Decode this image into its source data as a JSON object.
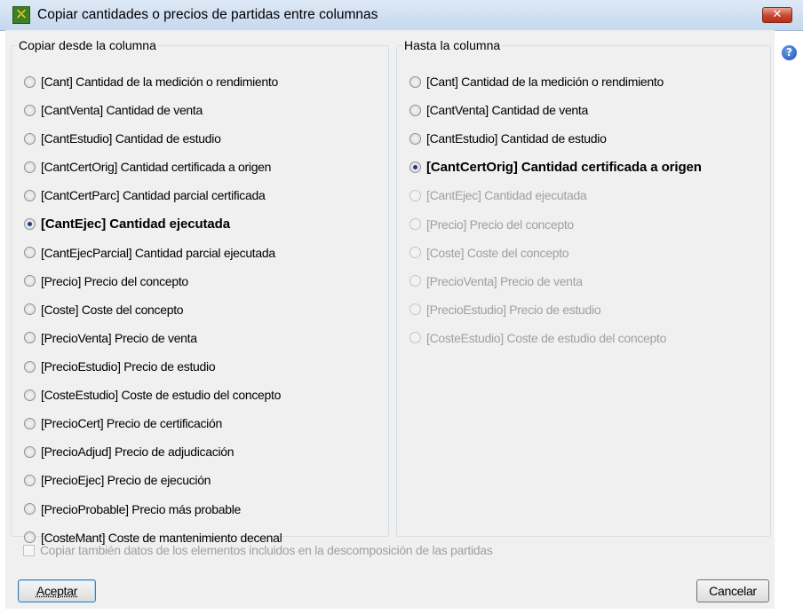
{
  "window": {
    "title": "Copiar cantidades o precios de partidas entre columnas",
    "close_symbol": "✕",
    "help_symbol": "?"
  },
  "from_group": {
    "title": "Copiar desde la columna",
    "options": [
      {
        "label": "[Cant] Cantidad de la medición o rendimiento",
        "selected": false,
        "enabled": true
      },
      {
        "label": "[CantVenta] Cantidad de venta",
        "selected": false,
        "enabled": true
      },
      {
        "label": "[CantEstudio] Cantidad de estudio",
        "selected": false,
        "enabled": true
      },
      {
        "label": "[CantCertOrig] Cantidad certificada a origen",
        "selected": false,
        "enabled": true
      },
      {
        "label": "[CantCertParc] Cantidad parcial certificada",
        "selected": false,
        "enabled": true
      },
      {
        "label": "[CantEjec] Cantidad ejecutada",
        "selected": true,
        "enabled": true
      },
      {
        "label": "[CantEjecParcial] Cantidad parcial ejecutada",
        "selected": false,
        "enabled": true
      },
      {
        "label": "[Precio] Precio del concepto",
        "selected": false,
        "enabled": true
      },
      {
        "label": "[Coste] Coste del concepto",
        "selected": false,
        "enabled": true
      },
      {
        "label": "[PrecioVenta] Precio de venta",
        "selected": false,
        "enabled": true
      },
      {
        "label": "[PrecioEstudio] Precio de estudio",
        "selected": false,
        "enabled": true
      },
      {
        "label": "[CosteEstudio] Coste de estudio del concepto",
        "selected": false,
        "enabled": true
      },
      {
        "label": "[PrecioCert] Precio de certificación",
        "selected": false,
        "enabled": true
      },
      {
        "label": "[PrecioAdjud] Precio de adjudicación",
        "selected": false,
        "enabled": true
      },
      {
        "label": "[PrecioEjec] Precio de ejecución",
        "selected": false,
        "enabled": true
      },
      {
        "label": "[PrecioProbable] Precio más probable",
        "selected": false,
        "enabled": true
      },
      {
        "label": "[CosteMant] Coste de mantenimiento decenal",
        "selected": false,
        "enabled": true
      }
    ]
  },
  "to_group": {
    "title": "Hasta la columna",
    "options": [
      {
        "label": "[Cant] Cantidad de la medición o rendimiento",
        "selected": false,
        "enabled": true
      },
      {
        "label": "[CantVenta] Cantidad de venta",
        "selected": false,
        "enabled": true
      },
      {
        "label": "[CantEstudio] Cantidad de estudio",
        "selected": false,
        "enabled": true
      },
      {
        "label": "[CantCertOrig] Cantidad certificada a origen",
        "selected": true,
        "enabled": true
      },
      {
        "label": "[CantEjec] Cantidad ejecutada",
        "selected": false,
        "enabled": false
      },
      {
        "label": "[Precio] Precio del concepto",
        "selected": false,
        "enabled": false
      },
      {
        "label": "[Coste] Coste del concepto",
        "selected": false,
        "enabled": false
      },
      {
        "label": "[PrecioVenta] Precio de venta",
        "selected": false,
        "enabled": false
      },
      {
        "label": "[PrecioEstudio] Precio de estudio",
        "selected": false,
        "enabled": false
      },
      {
        "label": "[CosteEstudio] Coste de estudio del concepto",
        "selected": false,
        "enabled": false
      }
    ]
  },
  "include_checkbox": {
    "label": "Copiar también datos de los elementos incluidos en la descomposición de las partidas",
    "checked": false,
    "enabled": false
  },
  "buttons": {
    "accept": "Aceptar",
    "cancel": "Cancelar"
  }
}
